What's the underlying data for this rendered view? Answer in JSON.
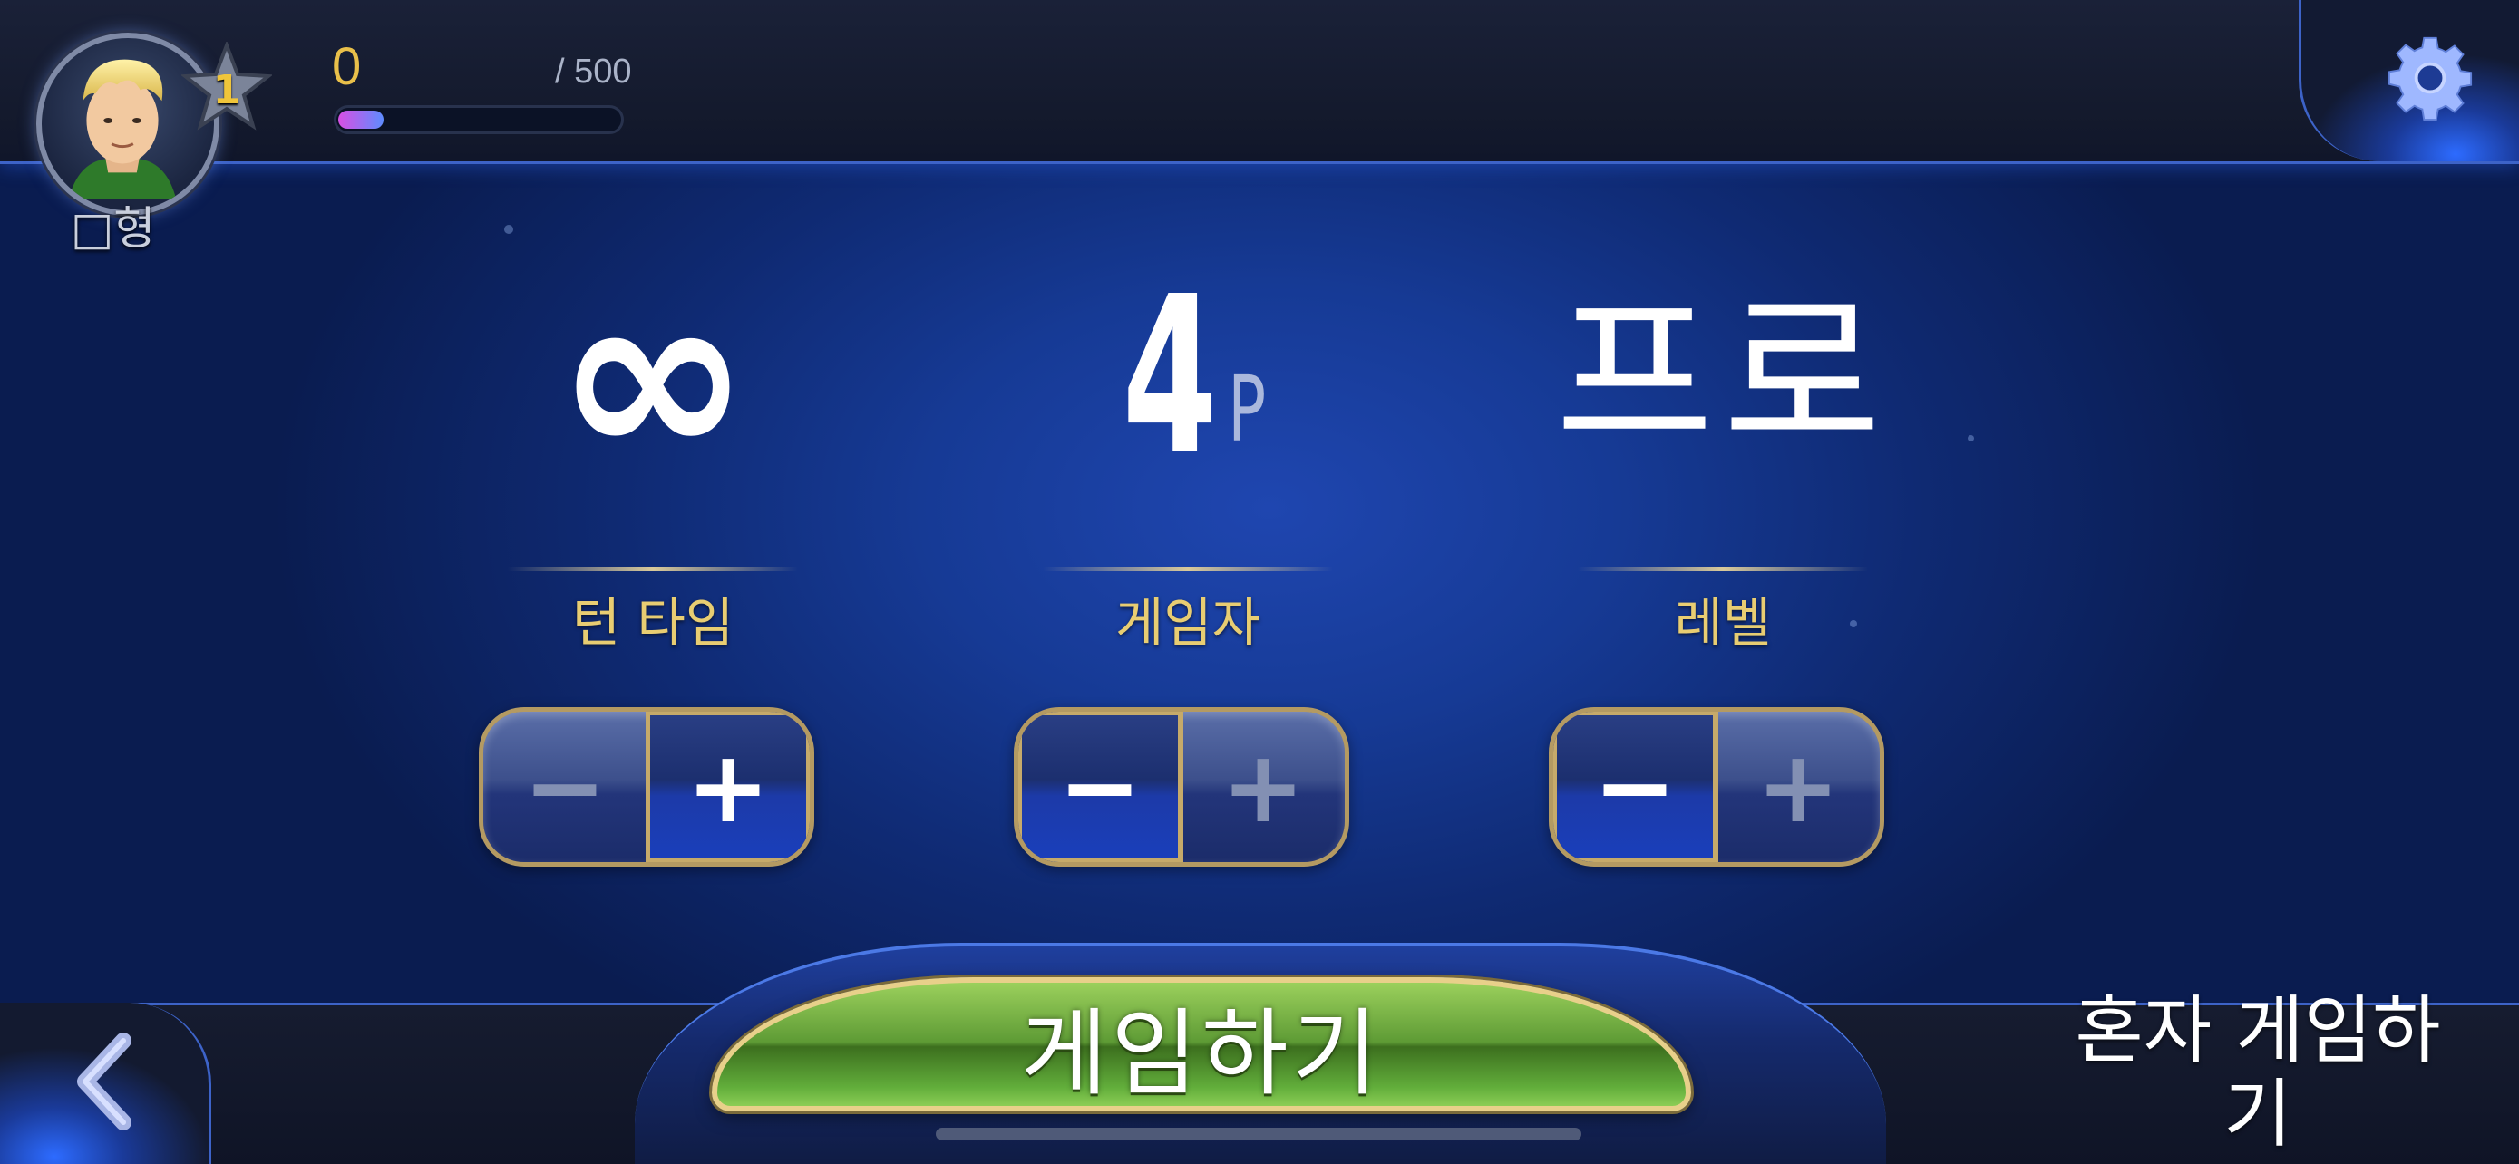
{
  "profile": {
    "name": "□형",
    "level": "1",
    "xp_value": "0",
    "xp_max": "/ 500",
    "xp_progress": 0.08
  },
  "settings": [
    {
      "id": "turn-time",
      "value": "∞",
      "label": "턴 타임",
      "active_side": "plus"
    },
    {
      "id": "players",
      "value": "4",
      "value_suffix": "P",
      "label": "게임자",
      "active_side": "minus"
    },
    {
      "id": "level",
      "value": "프로",
      "label": "레벨",
      "active_side": "minus"
    }
  ],
  "stepper": {
    "minus_symbol": "−",
    "plus_symbol": "+"
  },
  "actions": {
    "play_label": "게임하기",
    "solo_label": "혼자 게임하기"
  },
  "icons": {
    "settings": "gear-icon",
    "back": "chevron-left-icon",
    "level": "star-icon"
  },
  "colors": {
    "accent_gold": "#e8cd72",
    "play_green": "#5e9b35",
    "frame_blue": "#3d63c8",
    "xp_gradient_start": "#d84fe3",
    "xp_gradient_end": "#5e8cff"
  }
}
